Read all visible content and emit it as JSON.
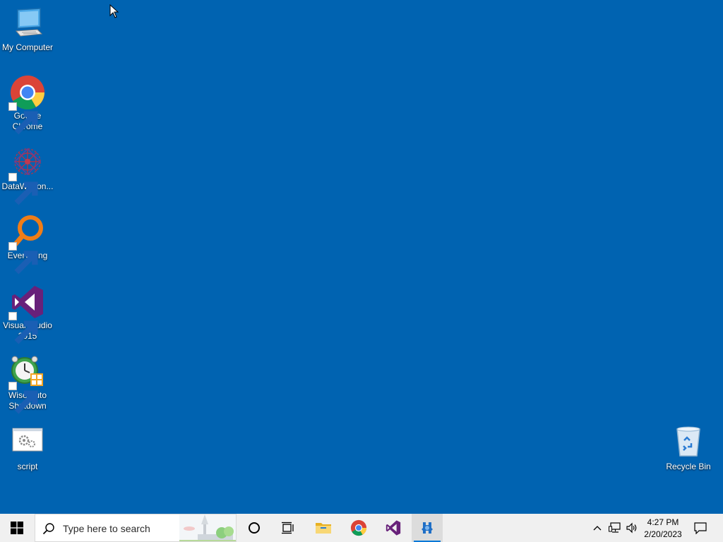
{
  "desktop": {
    "background_color": "#0063b1",
    "icons": [
      {
        "label": "My Computer",
        "icon": "computer-icon",
        "shortcut": false
      },
      {
        "label": "Google Chrome",
        "icon": "chrome-icon",
        "shortcut": true
      },
      {
        "label": "DataWagon...",
        "icon": "datawagon-icon",
        "shortcut": true
      },
      {
        "label": "Everything",
        "icon": "everything-icon",
        "shortcut": true
      },
      {
        "label": "Visual Studio 2015",
        "icon": "visual-studio-icon",
        "shortcut": true
      },
      {
        "label": "Wise Auto Shutdown",
        "icon": "wise-auto-shutdown-icon",
        "shortcut": true
      },
      {
        "label": "script",
        "icon": "script-file-icon",
        "shortcut": false
      },
      {
        "label": "Recycle Bin",
        "icon": "recycle-bin-icon",
        "shortcut": false
      }
    ]
  },
  "taskbar": {
    "search_placeholder": "Type here to search",
    "pinned": [
      {
        "name": "cortana",
        "icon": "cortana-circle-icon"
      },
      {
        "name": "task-view",
        "icon": "task-view-icon"
      },
      {
        "name": "file-explorer",
        "icon": "folder-icon"
      },
      {
        "name": "chrome",
        "icon": "chrome-icon"
      },
      {
        "name": "visual-studio",
        "icon": "visual-studio-icon"
      },
      {
        "name": "datawagon",
        "icon": "datawagon-icon",
        "active": true
      }
    ],
    "tray": {
      "time": "4:27 PM",
      "date": "2/20/2023"
    },
    "accent_color": "#0078d7"
  }
}
